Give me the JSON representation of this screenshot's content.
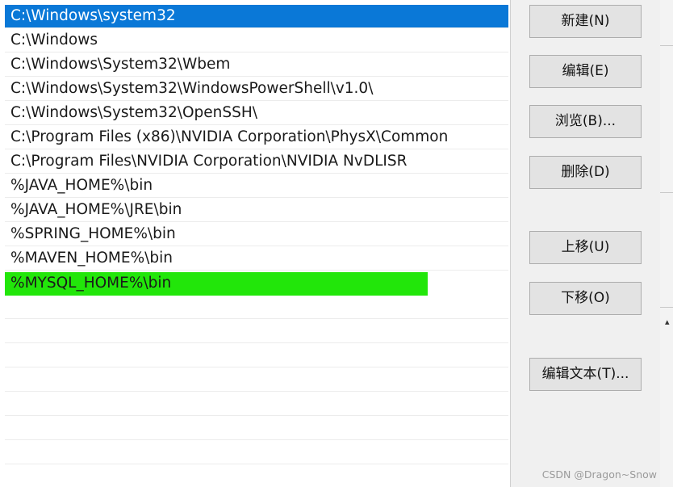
{
  "path_list": {
    "entries": [
      "C:\\Windows\\system32",
      "C:\\Windows",
      "C:\\Windows\\System32\\Wbem",
      "C:\\Windows\\System32\\WindowsPowerShell\\v1.0\\",
      "C:\\Windows\\System32\\OpenSSH\\",
      "C:\\Program Files (x86)\\NVIDIA Corporation\\PhysX\\Common",
      "C:\\Program Files\\NVIDIA Corporation\\NVIDIA NvDLISR",
      "%JAVA_HOME%\\bin",
      "%JAVA_HOME%\\JRE\\bin",
      "%SPRING_HOME%\\bin",
      "%MAVEN_HOME%\\bin",
      "%MYSQL_HOME%\\bin"
    ],
    "selected_index": 0,
    "highlighted_index": 11
  },
  "buttons": {
    "new": "新建(N)",
    "edit": "编辑(E)",
    "browse": "浏览(B)...",
    "delete": "删除(D)",
    "move_up": "上移(U)",
    "move_down": "下移(O)",
    "edit_text": "编辑文本(T)..."
  },
  "watermark": "CSDN @Dragon~Snow",
  "colors": {
    "selection": "#0a78d7",
    "highlight": "#22e60a"
  }
}
